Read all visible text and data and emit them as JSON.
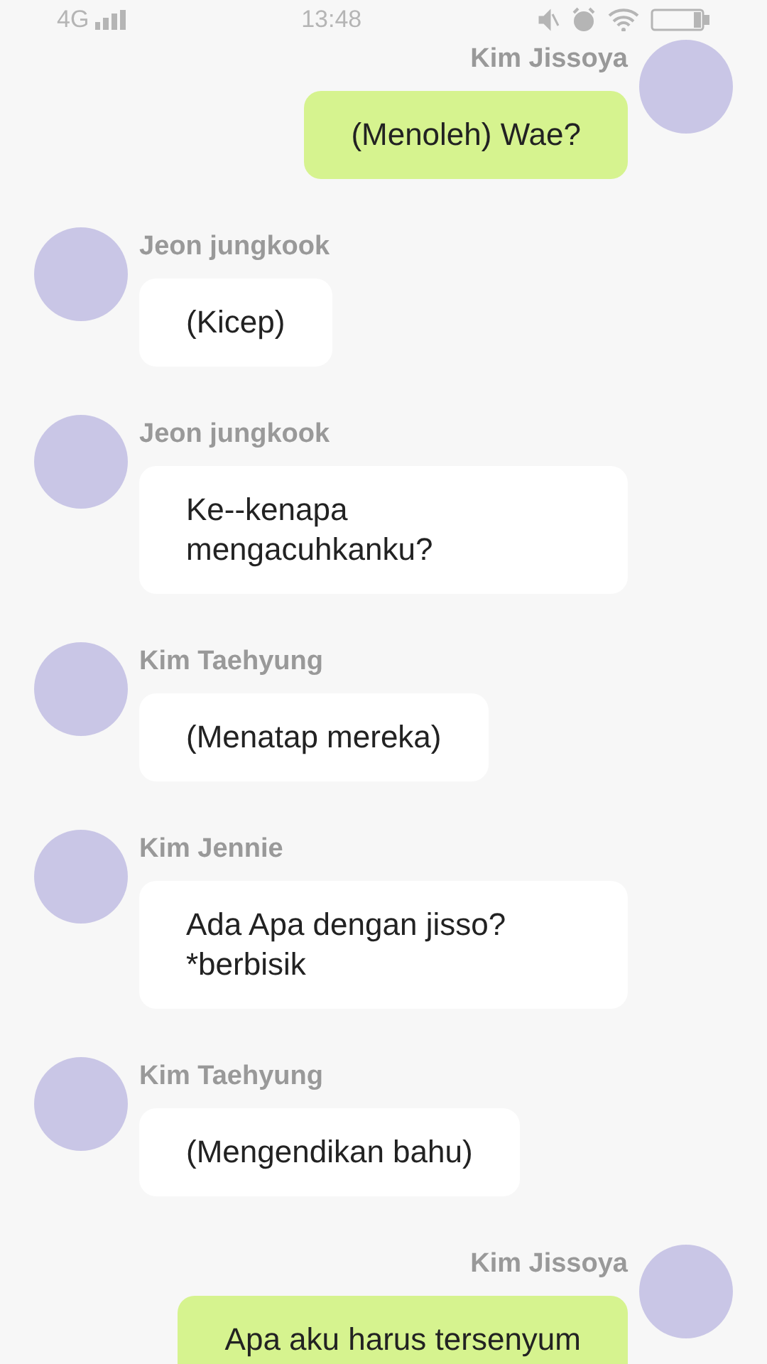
{
  "status_bar": {
    "network": "4G",
    "time": "13:48"
  },
  "messages": [
    {
      "kind": "outgoing",
      "sender": "Kim Jissoya",
      "text": "(Menoleh) Wae?"
    },
    {
      "kind": "incoming",
      "sender": "Jeon jungkook",
      "text": "(Kicep)"
    },
    {
      "kind": "incoming",
      "sender": "Jeon jungkook",
      "text": "Ke--kenapa mengacuhkanku?"
    },
    {
      "kind": "incoming",
      "sender": "Kim Taehyung",
      "text": "(Menatap mereka)"
    },
    {
      "kind": "incoming",
      "sender": "Kim Jennie",
      "text": "Ada Apa dengan jisso? *berbisik"
    },
    {
      "kind": "incoming",
      "sender": "Kim Taehyung",
      "text": "(Mengendikan bahu)"
    },
    {
      "kind": "outgoing",
      "sender": "Kim Jissoya",
      "text": "Apa aku harus tersenyum"
    }
  ]
}
